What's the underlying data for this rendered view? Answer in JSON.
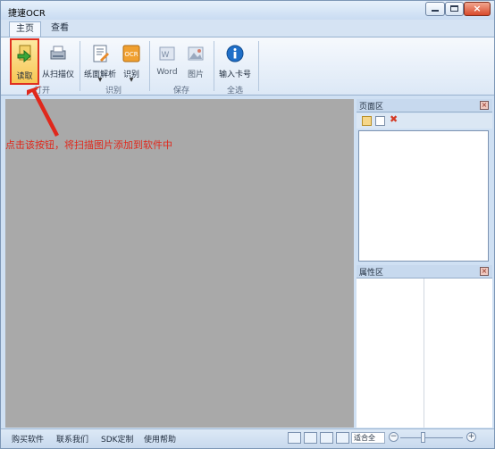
{
  "window": {
    "title": "捷速OCR"
  },
  "tabs": [
    {
      "label": "主页"
    },
    {
      "label": "查看"
    }
  ],
  "ribbon": {
    "groups": [
      {
        "label": "打开"
      },
      {
        "label": "识别"
      },
      {
        "label": "保存"
      },
      {
        "label": "全选"
      }
    ],
    "buttons": {
      "read": {
        "label": "读取",
        "icon": "read-file-icon"
      },
      "scanner": {
        "label": "从扫描仪",
        "icon": "scanner-icon"
      },
      "layout": {
        "label": "纸面解析",
        "icon": "layout-analysis-icon"
      },
      "recognize": {
        "label": "识别",
        "icon": "ocr-icon"
      },
      "word": {
        "label": "Word",
        "icon": "word-icon"
      },
      "image": {
        "label": "图片",
        "icon": "image-icon"
      },
      "input_card": {
        "label": "输入卡号",
        "icon": "info-icon"
      }
    }
  },
  "annotation": {
    "text": "点击该按钮，将扫描图片添加到软件中",
    "color": "#e0281c"
  },
  "panels": {
    "page_area": {
      "title": "页面区"
    },
    "property_area": {
      "title": "属性区"
    }
  },
  "statusbar": {
    "links": [
      "购买软件",
      "联系我们",
      "SDK定制",
      "使用帮助"
    ],
    "zoom": "适合全"
  },
  "colors": {
    "workspace": "#a9a9a9",
    "accent_highlight": "#e03020"
  }
}
